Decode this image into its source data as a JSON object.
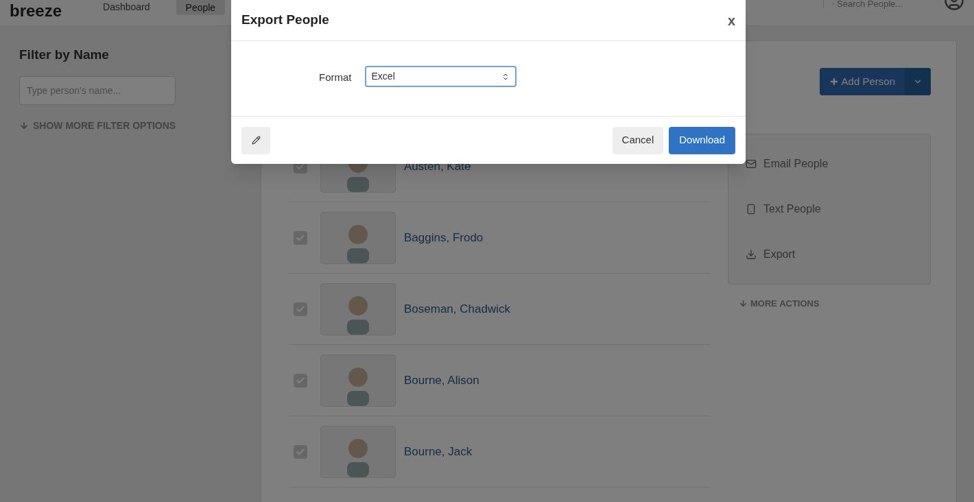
{
  "nav": {
    "logo": "breeze",
    "items": [
      {
        "label": "Dashboard",
        "selected": false
      },
      {
        "label": "People",
        "selected": true
      }
    ],
    "search": {
      "placeholder": "Search People..."
    }
  },
  "filter": {
    "title": "Filter by Name",
    "placeholder": "Type person's name...",
    "more_link": "SHOW MORE FILTER OPTIONS"
  },
  "people": [
    {
      "name": "Austen, Kate",
      "checked": true
    },
    {
      "name": "Baggins, Frodo",
      "checked": true
    },
    {
      "name": "Boseman, Chadwick",
      "checked": true
    },
    {
      "name": "Bourne, Alison",
      "checked": true
    },
    {
      "name": "Bourne, Jack",
      "checked": true
    }
  ],
  "add_button": "Add Person",
  "actions": [
    {
      "kind": "email",
      "label": "Email People"
    },
    {
      "kind": "text",
      "label": "Text People"
    },
    {
      "kind": "export",
      "label": "Export"
    }
  ],
  "more_actions": "MORE ACTIONS",
  "modal": {
    "title": "Export People",
    "close": "x",
    "format_label": "Format",
    "format_value": "Excel",
    "cancel": "Cancel",
    "download": "Download"
  }
}
